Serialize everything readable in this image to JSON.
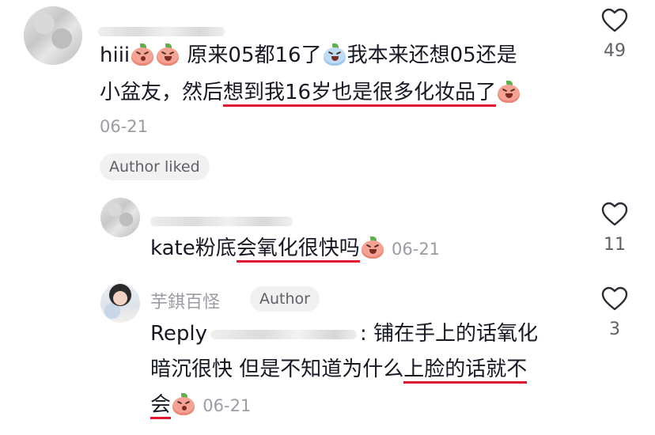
{
  "comments": [
    {
      "line1": [
        "hiii",
        "原来05都16了",
        "我本来还想05还是"
      ],
      "line2_plain": "小盆友，然后",
      "line2_underlined": "想到我16岁也是很多化妆品了",
      "date": "06-21",
      "badge": "Author liked",
      "likes": "49"
    },
    {
      "text_plain": "kate粉底",
      "text_underlined": "会氧化很快吗",
      "date": "06-21",
      "likes": "11"
    },
    {
      "username": "芋錤百怪",
      "author_tag": "Author",
      "reply_prefix": "Reply",
      "line1_after": ": 铺在手上的话氧化",
      "line2_plain": "暗沉很快 但是不知道为什么",
      "line2_underlined": "上脸的话就不",
      "line3_underlined": "会",
      "date": "06-21",
      "likes": "3"
    }
  ],
  "icons": {
    "like": "heart-outline-icon",
    "emoji_laugh": "peach-laugh-emoji",
    "emoji_cry": "peach-cry-emoji",
    "emoji_cover_mouth": "peach-cover-mouth-emoji"
  },
  "colors": {
    "underline": "#e0182f",
    "meta": "#9a9ca3",
    "text": "#161823"
  }
}
